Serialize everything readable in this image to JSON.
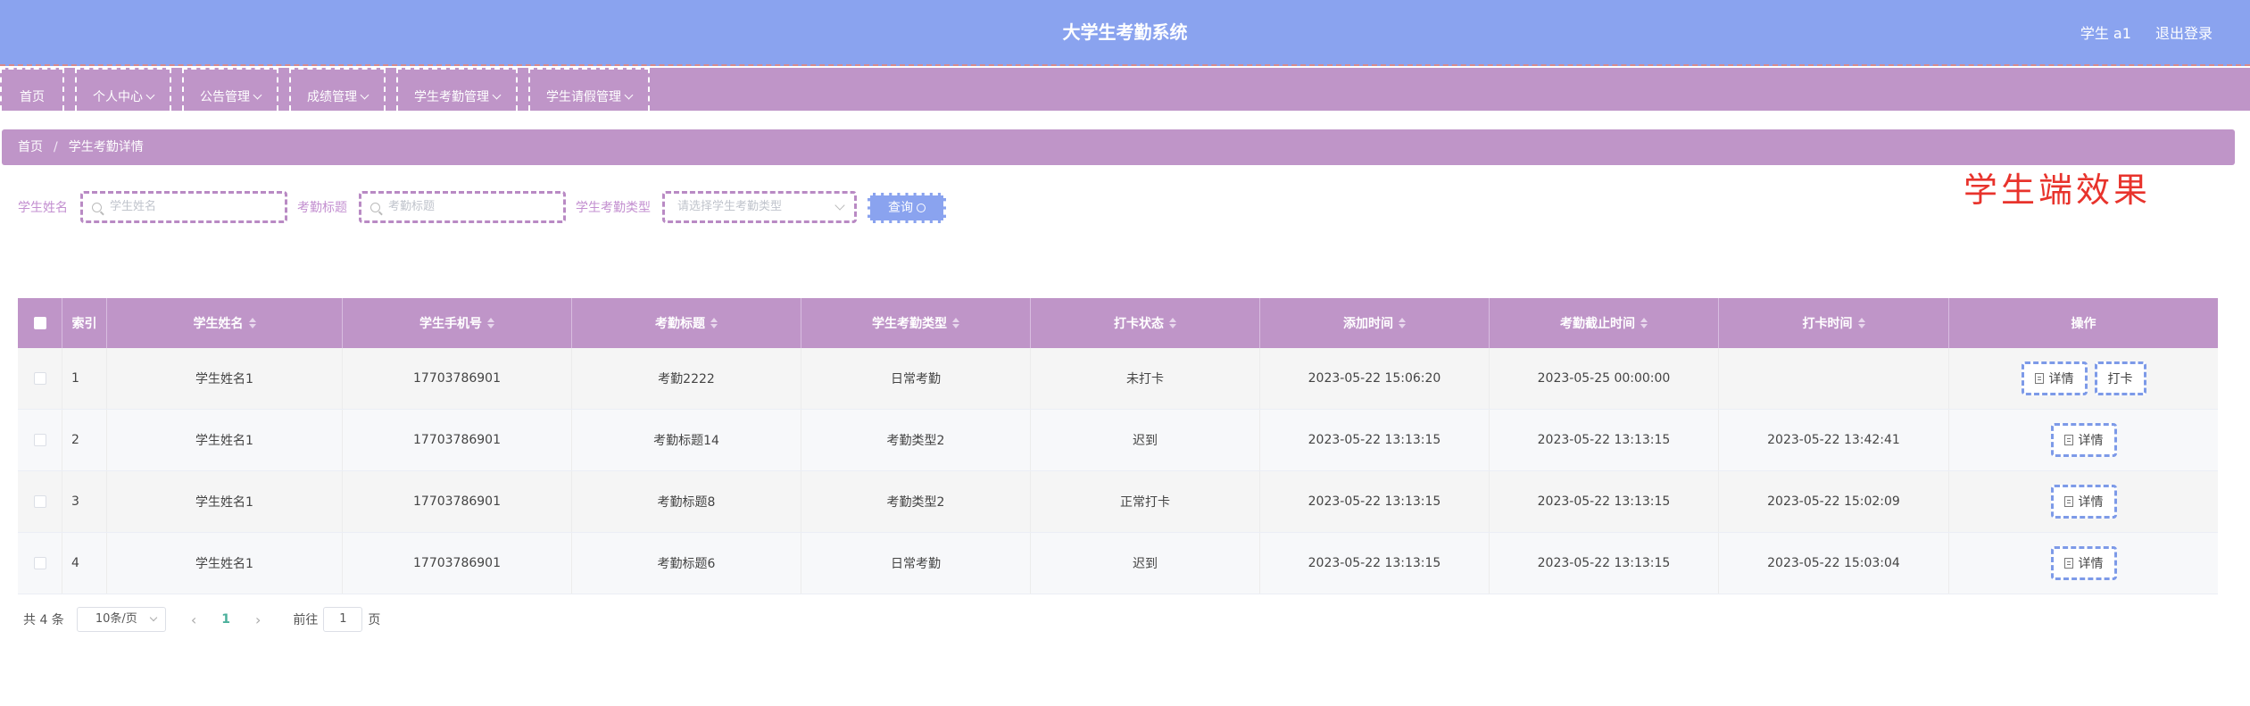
{
  "header": {
    "title": "大学生考勤系统",
    "user": "学生 a1",
    "logout": "退出登录"
  },
  "nav": [
    {
      "label": "首页",
      "dropdown": false
    },
    {
      "label": "个人中心",
      "dropdown": true
    },
    {
      "label": "公告管理",
      "dropdown": true
    },
    {
      "label": "成绩管理",
      "dropdown": true
    },
    {
      "label": "学生考勤管理",
      "dropdown": true
    },
    {
      "label": "学生请假管理",
      "dropdown": true
    }
  ],
  "breadcrumb": {
    "home": "首页",
    "sep": "/",
    "current": "学生考勤详情"
  },
  "filters": {
    "name_label": "学生姓名",
    "name_placeholder": "学生姓名",
    "title_label": "考勤标题",
    "title_placeholder": "考勤标题",
    "type_label": "学生考勤类型",
    "type_placeholder": "请选择学生考勤类型",
    "query_label": "查询"
  },
  "annotation": "学生端效果",
  "table": {
    "headers": [
      "索引",
      "学生姓名",
      "学生手机号",
      "考勤标题",
      "学生考勤类型",
      "打卡状态",
      "添加时间",
      "考勤截止时间",
      "打卡时间",
      "操作"
    ],
    "rows": [
      {
        "index": "1",
        "name": "学生姓名1",
        "phone": "17703786901",
        "title": "考勤2222",
        "type": "日常考勤",
        "status": "未打卡",
        "added": "2023-05-22 15:06:20",
        "deadline": "2023-05-25 00:00:00",
        "checkin": "",
        "actions": [
          "详情",
          "打卡"
        ]
      },
      {
        "index": "2",
        "name": "学生姓名1",
        "phone": "17703786901",
        "title": "考勤标题14",
        "type": "考勤类型2",
        "status": "迟到",
        "added": "2023-05-22 13:13:15",
        "deadline": "2023-05-22 13:13:15",
        "checkin": "2023-05-22 13:42:41",
        "actions": [
          "详情"
        ]
      },
      {
        "index": "3",
        "name": "学生姓名1",
        "phone": "17703786901",
        "title": "考勤标题8",
        "type": "考勤类型2",
        "status": "正常打卡",
        "added": "2023-05-22 13:13:15",
        "deadline": "2023-05-22 13:13:15",
        "checkin": "2023-05-22 15:02:09",
        "actions": [
          "详情"
        ]
      },
      {
        "index": "4",
        "name": "学生姓名1",
        "phone": "17703786901",
        "title": "考勤标题6",
        "type": "日常考勤",
        "status": "迟到",
        "added": "2023-05-22 13:13:15",
        "deadline": "2023-05-22 13:13:15",
        "checkin": "2023-05-22 15:03:04",
        "actions": [
          "详情"
        ]
      }
    ]
  },
  "pagination": {
    "total": "共 4 条",
    "page_size": "10条/页",
    "prev": "‹",
    "current": "1",
    "next": "›",
    "goto_label": "前往",
    "goto_value": "1",
    "goto_suffix": "页"
  }
}
